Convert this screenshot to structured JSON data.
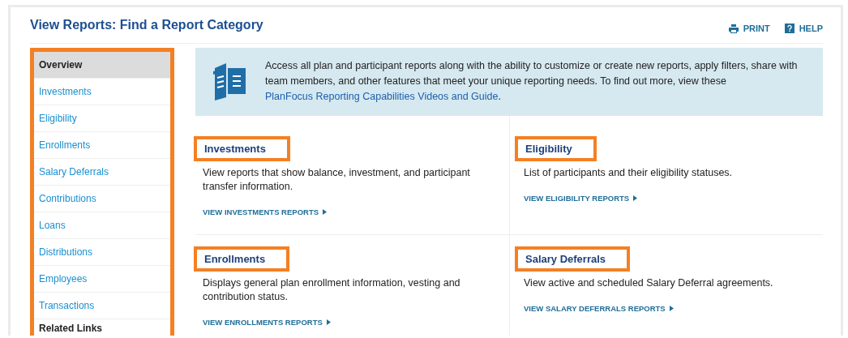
{
  "page_title": "View Reports: Find a Report Category",
  "actions": [
    {
      "kind": "print",
      "label": "PRINT"
    },
    {
      "kind": "help",
      "label": "HELP"
    }
  ],
  "sidebar": {
    "highlighted": true,
    "items": [
      {
        "label": "Overview",
        "selected": true
      },
      {
        "label": "Investments",
        "selected": false
      },
      {
        "label": "Eligibility",
        "selected": false
      },
      {
        "label": "Enrollments",
        "selected": false
      },
      {
        "label": "Salary Deferrals",
        "selected": false
      },
      {
        "label": "Contributions",
        "selected": false
      },
      {
        "label": "Loans",
        "selected": false
      },
      {
        "label": "Distributions",
        "selected": false
      },
      {
        "label": "Employees",
        "selected": false
      },
      {
        "label": "Transactions",
        "selected": false
      }
    ],
    "related_heading": "Related Links"
  },
  "info_banner": {
    "text": "Access all plan and participant reports along with the ability to customize or create new reports, apply filters, share with team members, and other features that meet your unique reporting needs. To find out more, view these ",
    "link": "PlanFocus Reporting Capabilities Videos and Guide",
    "after": "."
  },
  "categories": [
    {
      "title": "Investments",
      "highlighted": true,
      "description": "View reports that show balance, investment, and participant transfer information.",
      "link": "VIEW INVESTMENTS REPORTS"
    },
    {
      "title": "Eligibility",
      "highlighted": true,
      "description": "List of participants and their eligibility statuses.",
      "link": "VIEW ELIGIBILITY REPORTS"
    },
    {
      "title": "Enrollments",
      "highlighted": true,
      "description": "Displays general plan enrollment information, vesting and contribution status.",
      "link": "VIEW ENROLLMENTS REPORTS"
    },
    {
      "title": "Salary Deferrals",
      "highlighted": true,
      "description": "View active and scheduled Salary Deferral agreements.",
      "link": "VIEW SALARY DEFERRALS REPORTS"
    }
  ]
}
